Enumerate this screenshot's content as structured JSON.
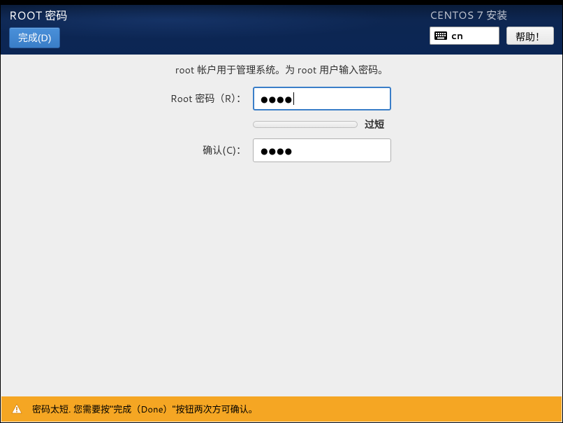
{
  "header": {
    "title": "ROOT 密码",
    "done_label": "完成(D)",
    "distro": "CENTOS 7 安装",
    "keyboard_layout": "cn",
    "help_label": "帮助！"
  },
  "main": {
    "description": "root 帐户用于管理系统。为 root 用户输入密码。",
    "password_label": "Root 密码（R）：",
    "password_value": "●●●●",
    "strength_text": "过短",
    "confirm_label": "确认(C)：",
    "confirm_value": "●●●●"
  },
  "warning": {
    "message": "密码太短. 您需要按\"完成（Done）\"按钮两次方可确认。"
  }
}
